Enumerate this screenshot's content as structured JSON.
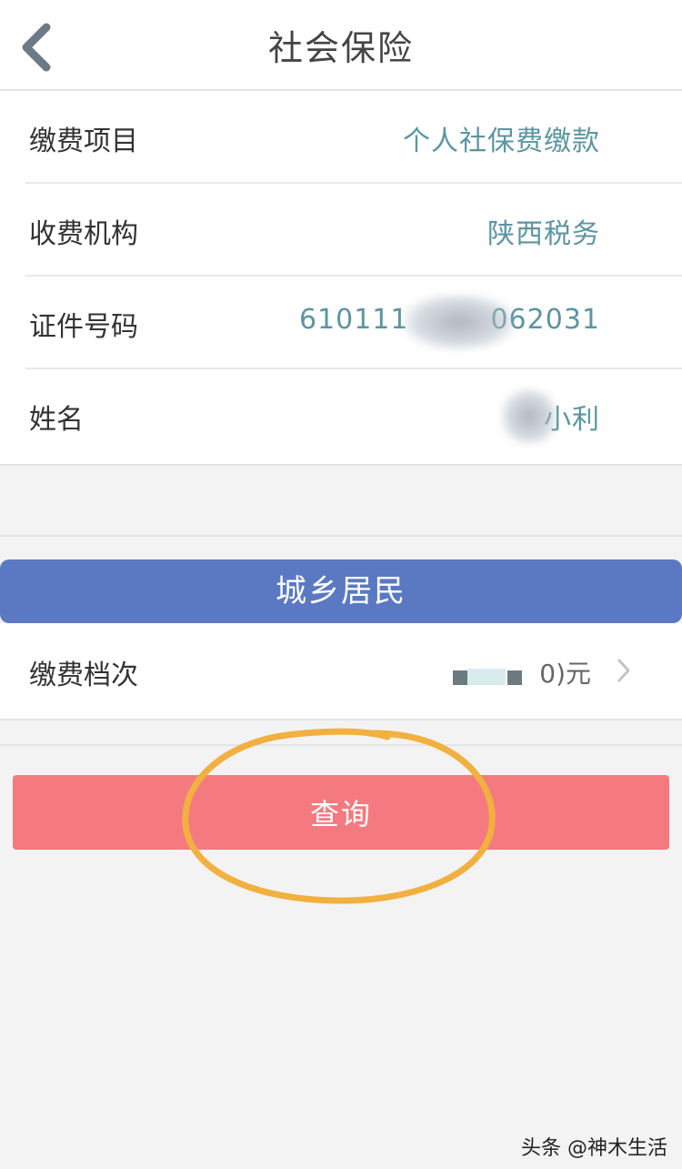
{
  "header": {
    "title": "社会保险",
    "back_icon": "chevron-left-icon"
  },
  "info": {
    "rows": [
      {
        "label": "缴费项目",
        "value": "个人社保费缴款"
      },
      {
        "label": "收费机构",
        "value": "陕西税务"
      },
      {
        "label": "证件号码",
        "value_prefix": "610111",
        "value_suffix": "062031"
      },
      {
        "label": "姓名",
        "value": "小利"
      }
    ]
  },
  "banner": {
    "label": "城乡居民",
    "color": "#5a79c2"
  },
  "level": {
    "label": "缴费档次",
    "value": "0)元",
    "chevron_icon": "chevron-right-icon"
  },
  "query": {
    "label": "查询",
    "color": "#f47a80",
    "annotation_color": "#f2b040"
  },
  "watermark": {
    "text": "头条 @神木生活"
  }
}
